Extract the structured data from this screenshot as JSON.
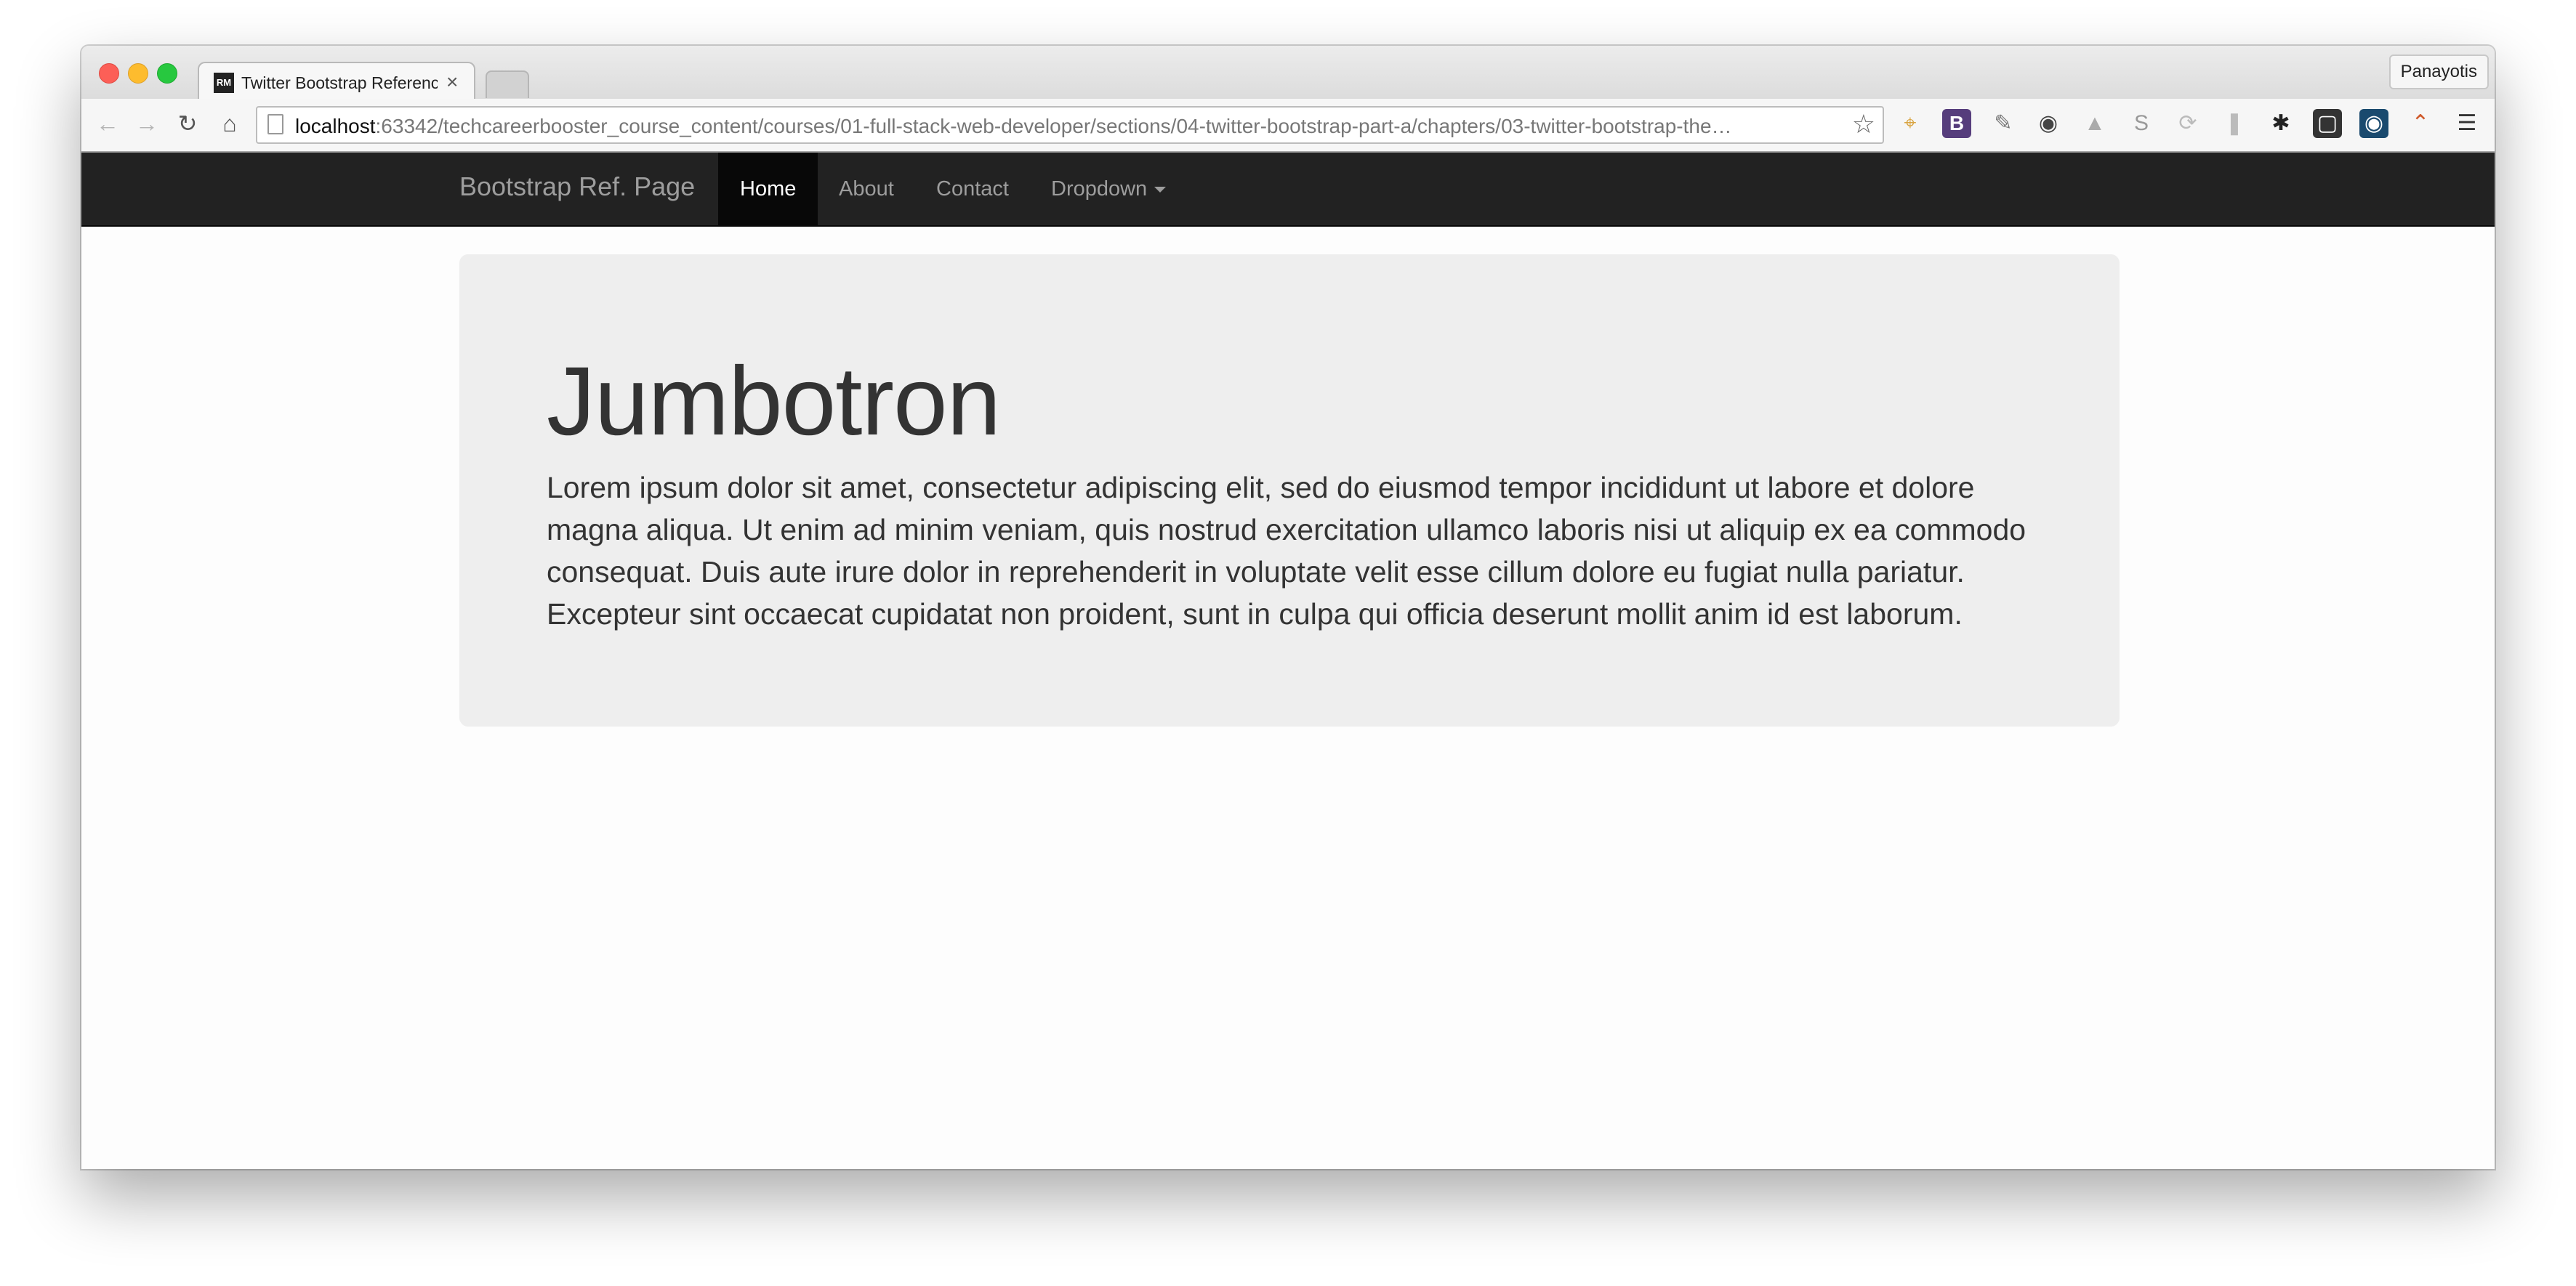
{
  "browser": {
    "tab_title": "Twitter Bootstrap Reference",
    "tab_favicon_text": "RM",
    "profile_name": "Panayotis",
    "url_host": "localhost",
    "url_rest": ":63342/techcareerbooster_course_content/courses/01-full-stack-web-developer/sections/04-twitter-bootstrap-part-a/chapters/03-twitter-bootstrap-the…",
    "toolbar_icons": [
      "back-arrow-icon",
      "forward-arrow-icon",
      "reload-icon",
      "home-icon",
      "star-icon"
    ],
    "extensions": [
      "ruler-extension-icon",
      "bootstrap-extension-icon",
      "eyedropper-extension-icon",
      "evernote-extension-icon",
      "sitemap-extension-icon",
      "skype-extension-icon",
      "refresh-extension-icon",
      "pause-extension-icon",
      "settings-extension-icon",
      "screenshot-extension-icon",
      "webapp-extension-icon",
      "chart-extension-icon",
      "menu-icon"
    ]
  },
  "navbar": {
    "brand": "Bootstrap Ref. Page",
    "items": [
      {
        "label": "Home",
        "active": true
      },
      {
        "label": "About",
        "active": false
      },
      {
        "label": "Contact",
        "active": false
      },
      {
        "label": "Dropdown",
        "active": false
      }
    ]
  },
  "jumbotron": {
    "title": "Jumbotron",
    "text": "Lorem ipsum dolor sit amet, consectetur adipiscing elit, sed do eiusmod tempor incididunt ut labore et dolore magna aliqua. Ut enim ad minim veniam, quis nostrud exercitation ullamco laboris nisi ut aliquip ex ea commodo consequat. Duis aute irure dolor in reprehenderit in voluptate velit esse cillum dolore eu fugiat nulla pariatur. Excepteur sint occaecat cupidatat non proident, sunt in culpa qui officia deserunt mollit anim id est laborum."
  },
  "colors": {
    "navbar_bg": "#222222",
    "navbar_active_bg": "#080808",
    "jumbotron_bg": "#eeeeee",
    "text": "#333333"
  }
}
